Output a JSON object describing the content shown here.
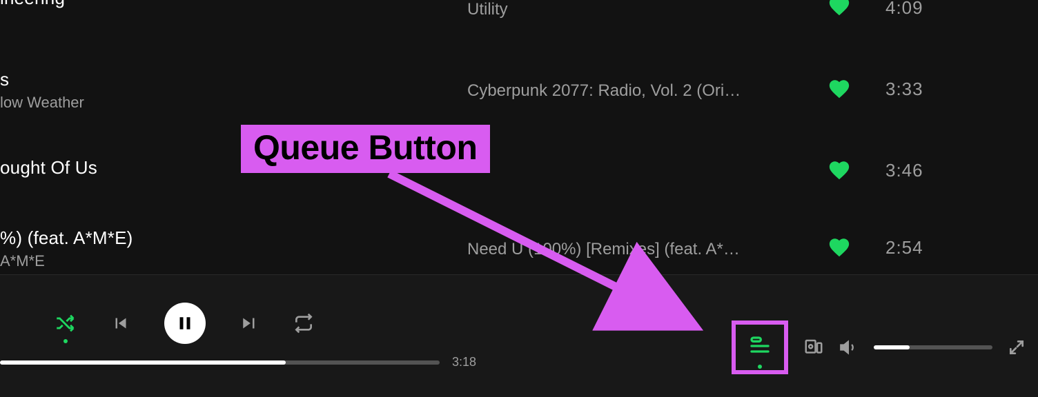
{
  "tracks": [
    {
      "title": "ineering",
      "artist": "",
      "album": "Utility",
      "duration": "4:09",
      "liked": true
    },
    {
      "title": "s",
      "artist": "low Weather",
      "album": "Cyberpunk 2077: Radio, Vol. 2 (Ori…",
      "duration": "3:33",
      "liked": true
    },
    {
      "title": "ought Of Us",
      "artist": "",
      "album": "",
      "duration": "3:46",
      "liked": true
    },
    {
      "title": "%) (feat. A*M*E)",
      "artist": "A*M*E",
      "album": "Need U (100%) [Remixes] (feat. A*…",
      "duration": "2:54",
      "liked": true
    }
  ],
  "player": {
    "total_time": "3:18"
  },
  "annotation": {
    "label": "Queue Button"
  }
}
